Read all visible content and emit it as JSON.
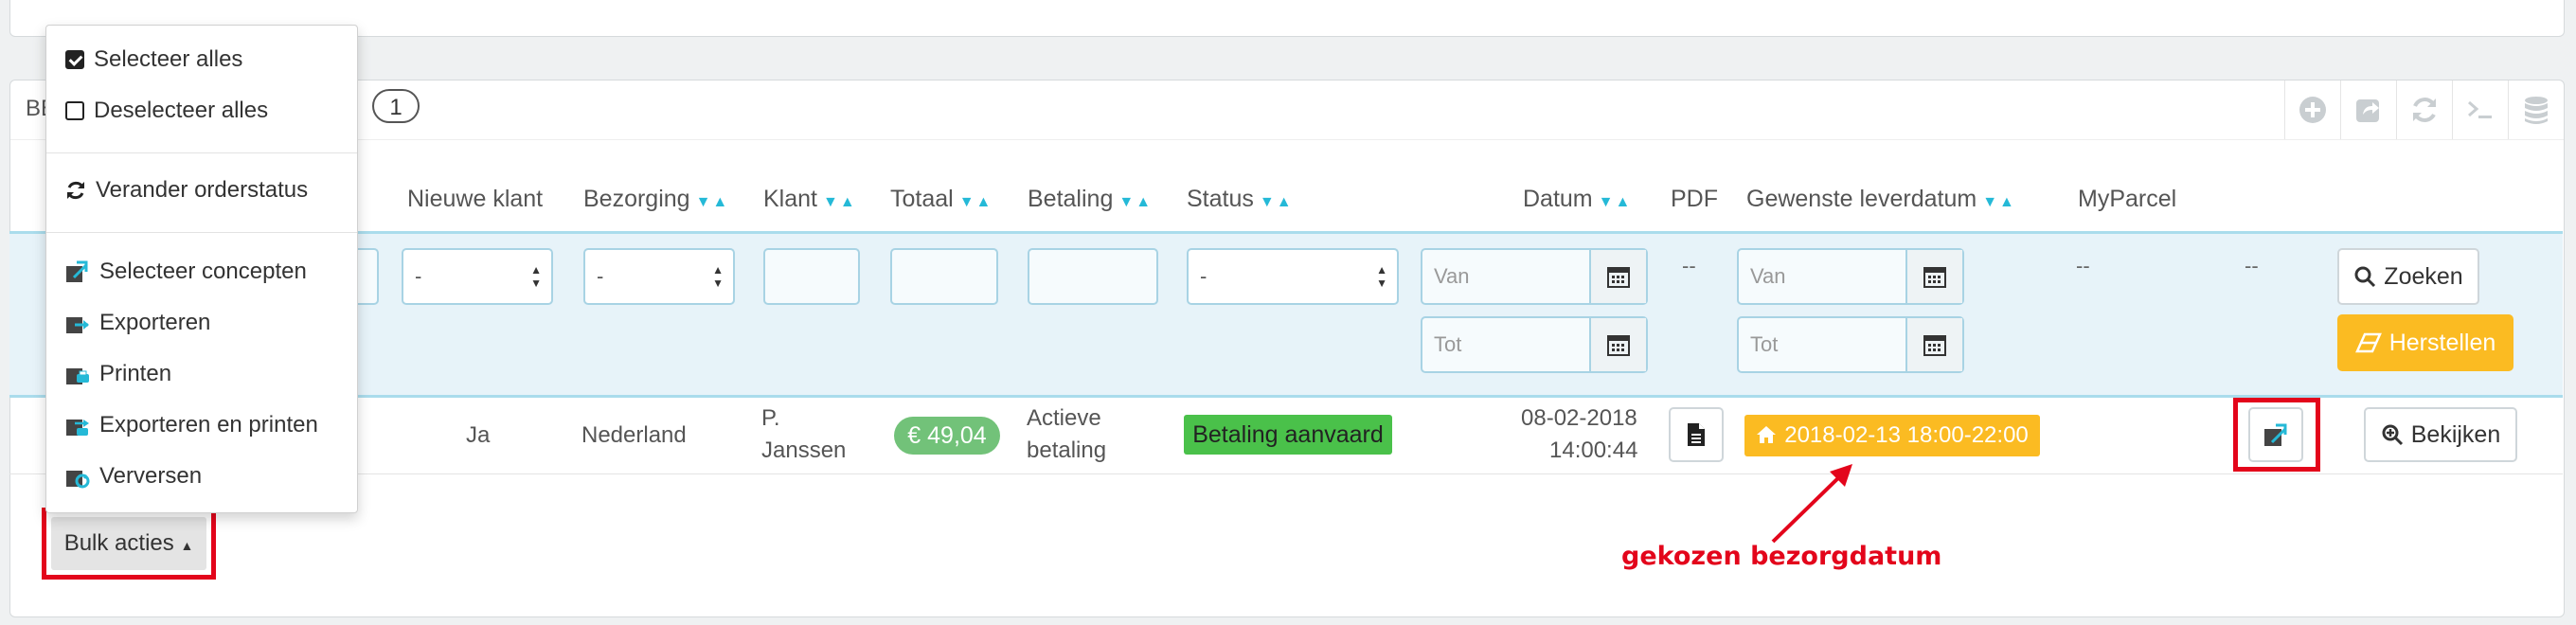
{
  "panel": {
    "heading_prefix": "BE",
    "count": "1"
  },
  "toolbar": {
    "icons": [
      "add-icon",
      "export-icon",
      "refresh-icon",
      "sql-icon",
      "database-icon"
    ]
  },
  "columns": {
    "nieuwe_klant": "Nieuwe klant",
    "bezorging": "Bezorging",
    "klant": "Klant",
    "totaal": "Totaal",
    "betaling": "Betaling",
    "status": "Status",
    "datum": "Datum",
    "pdf": "PDF",
    "leverdatum": "Gewenste leverdatum",
    "myparcel": "MyParcel"
  },
  "filters": {
    "select_default": "-",
    "van": "Van",
    "tot": "Tot",
    "dash": "--",
    "search_label": "Zoeken",
    "reset_label": "Herstellen"
  },
  "order": {
    "nieuwe_klant": "Ja",
    "bezorging": "Nederland",
    "klant_line1": "P.",
    "klant_line2": "Janssen",
    "totaal": "€ 49,04",
    "betaling_line1": "Actieve",
    "betaling_line2": "betaling",
    "status": "Betaling aanvaard",
    "datum_line1": "08-02-2018",
    "datum_line2": "14:00:44",
    "leverdatum": "2018-02-13 18:00-22:00",
    "view_label": "Bekijken"
  },
  "dropdown": {
    "select_all": "Selecteer alles",
    "deselect_all": "Deselecteer alles",
    "change_status": "Verander orderstatus",
    "select_concepts": "Selecteer concepten",
    "export": "Exporteren",
    "print": "Printen",
    "export_print": "Exporteren en printen",
    "refresh": "Verversen"
  },
  "bulk": {
    "label": "Bulk acties"
  },
  "annotation": {
    "text": "gekozen bezorgdatum"
  },
  "colors": {
    "accent": "#25b9d7",
    "warning": "#fbbb22",
    "success": "#4ac14a",
    "highlight": "#e3051b"
  }
}
